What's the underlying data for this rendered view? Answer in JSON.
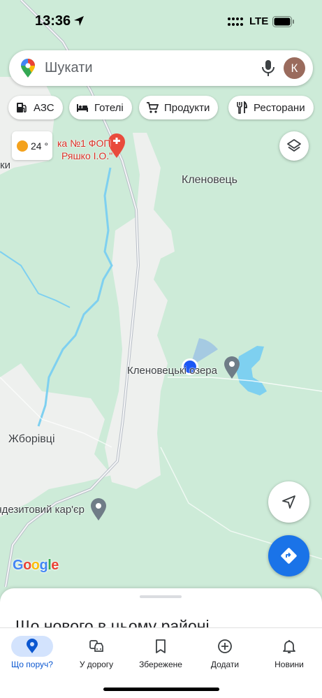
{
  "status_bar": {
    "time": "13:36",
    "network": "LTE"
  },
  "search": {
    "placeholder": "Шукати",
    "avatar_letter": "К"
  },
  "chips": [
    {
      "label": "АЗС",
      "icon": "gas-station-icon"
    },
    {
      "label": "Готелі",
      "icon": "hotel-bed-icon"
    },
    {
      "label": "Продукти",
      "icon": "shopping-cart-icon"
    },
    {
      "label": "Ресторани",
      "icon": "restaurant-icon"
    }
  ],
  "weather": {
    "temperature": "24 °",
    "icon": "sun-icon"
  },
  "map": {
    "labels": {
      "edge_left": "ки",
      "pharmacy_line1": "ка №1 ФОП",
      "pharmacy_line2": "Ряшко І.О.\"",
      "village_top": "Кленовець",
      "lakes": "Кленовецькі озера",
      "village_left": "Жборівці",
      "quarry": "андезитовий кар'єр"
    },
    "attribution": "Google",
    "colors": {
      "land": "#cdebd8",
      "urban": "#eef0ee",
      "water": "#7ed0f0",
      "road": "#b8bec7",
      "location": "#1a57f5"
    }
  },
  "sheet": {
    "title": "Що нового в цьому районі"
  },
  "nav": {
    "items": [
      {
        "label": "Що поруч?",
        "icon": "explore-pin-icon",
        "active": true
      },
      {
        "label": "У дорогу",
        "icon": "commute-car-icon",
        "active": false
      },
      {
        "label": "Збережене",
        "icon": "bookmark-icon",
        "active": false
      },
      {
        "label": "Додати",
        "icon": "add-circle-icon",
        "active": false
      },
      {
        "label": "Новини",
        "icon": "bell-icon",
        "active": false
      }
    ]
  }
}
